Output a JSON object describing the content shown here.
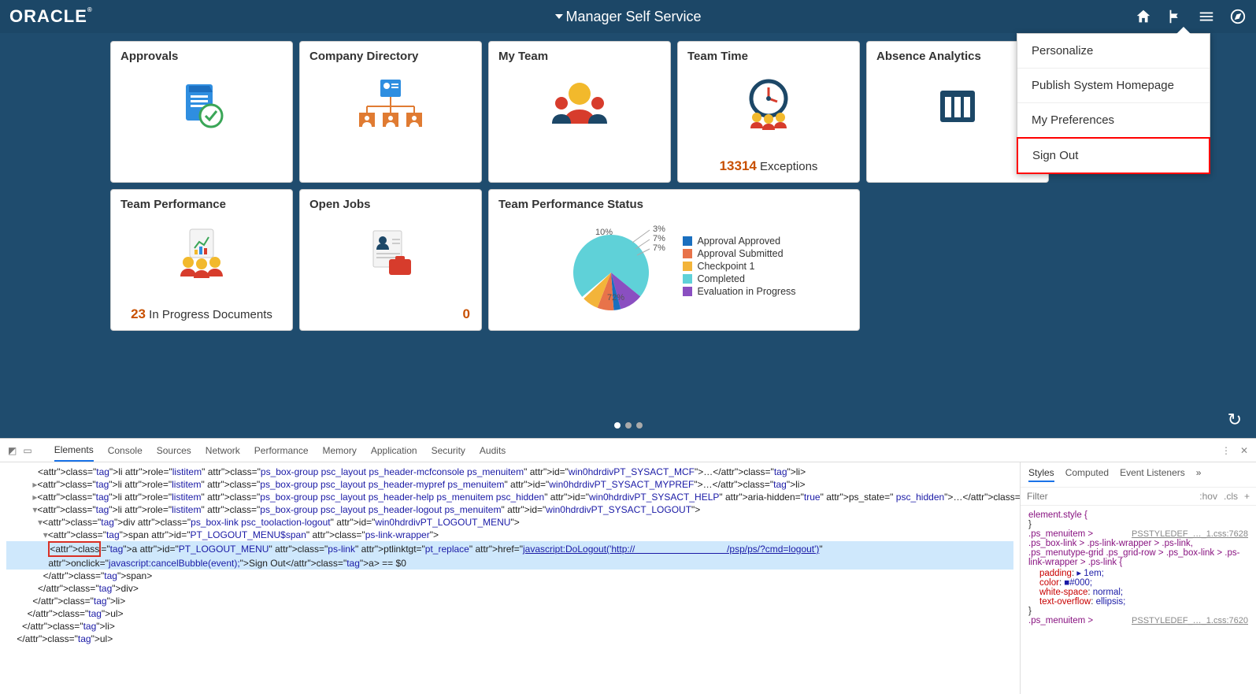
{
  "header": {
    "logo": "ORACLE",
    "title": "Manager Self Service"
  },
  "menu": {
    "items": [
      "Personalize",
      "Publish System Homepage",
      "My Preferences",
      "Sign Out"
    ],
    "highlight_index": 3
  },
  "tiles": {
    "approvals": {
      "title": "Approvals"
    },
    "directory": {
      "title": "Company Directory"
    },
    "myteam": {
      "title": "My Team"
    },
    "teamtime": {
      "title": "Team Time",
      "count": "13314",
      "label": "Exceptions"
    },
    "absence": {
      "title": "Absence Analytics"
    },
    "perf": {
      "title": "Team Performance",
      "count": "23",
      "label": "In Progress Documents"
    },
    "openjobs": {
      "title": "Open Jobs",
      "count": "0"
    },
    "status": {
      "title": "Team Performance Status"
    }
  },
  "chart_data": {
    "type": "pie",
    "slices": [
      {
        "label": "Approval Approved",
        "value": 3,
        "color": "#1a6fbf",
        "pct": "3%"
      },
      {
        "label": "Approval Submitted",
        "value": 7,
        "color": "#e8734a",
        "pct": "7%"
      },
      {
        "label": "Checkpoint 1",
        "value": 7,
        "color": "#f3b43a",
        "pct": "7%"
      },
      {
        "label": "Completed",
        "value": 72,
        "color": "#5fd1d8",
        "pct": "72%"
      },
      {
        "label": "Evaluation in Progress",
        "value": 10,
        "color": "#8a4fc1",
        "pct": "10%"
      }
    ],
    "label72": "72%",
    "label10": "10%",
    "label3": "3%",
    "label7a": "7%",
    "label7b": "7%"
  },
  "devtools": {
    "tabs": [
      "Elements",
      "Console",
      "Sources",
      "Network",
      "Performance",
      "Memory",
      "Application",
      "Security",
      "Audits"
    ],
    "side_tabs": [
      "Styles",
      "Computed",
      "Event Listeners"
    ],
    "filter_placeholder": "Filter",
    "hov": ":hov",
    "cls": ".cls",
    "rule1_sel": "element.style {",
    "rule2_sel": ".ps_menuitem >",
    "rule2_src": "PSSTYLEDEF_…_1.css:7628",
    "rule3_sel": ".ps_box-link > .ps-link-wrapper > .ps-link, .ps_menutype-grid .ps_grid-row > .ps_box-link > .ps-link-wrapper > .ps-link {",
    "p1": "padding",
    "v1": "▸ 1em;",
    "p2": "color",
    "v2": "■#000;",
    "p3": "white-space",
    "v3": "normal;",
    "p4": "text-overflow",
    "v4": "ellipsis;",
    "rule4_sel": ".ps_menuitem >",
    "rule4_src": "PSSTYLEDEF_…_1.css:7620",
    "dom": {
      "l1_pre": "<li role=\"listitem\" class=\"ps_box-group psc_layout ps_header-mcfconsole ps_menuitem\" id=\"win0hdrdivPT_SYSACT_MCF\">…</li>",
      "l2": "▸<li role=\"listitem\" class=\"ps_box-group psc_layout ps_header-mypref ps_menuitem\" id=\"win0hdrdivPT_SYSACT_MYPREF\">…</li>",
      "l3": "▸<li role=\"listitem\" class=\"ps_box-group psc_layout ps_header-help ps_menuitem psc_hidden\" id=\"win0hdrdivPT_SYSACT_HELP\" aria-hidden=\"true\" ps_state=\" psc_hidden\">…</li>",
      "l4": "▾<li role=\"listitem\" class=\"ps_box-group psc_layout ps_header-logout ps_menuitem\" id=\"win0hdrdivPT_SYSACT_LOGOUT\">",
      "l5": "▾<div class=\"ps_box-link psc_toolaction-logout\" id=\"win0hdrdivPT_LOGOUT_MENU\">",
      "l6": "▾<span id=\"PT_LOGOUT_MENU$span\" class=\"ps-link-wrapper\">",
      "l7a": "<a id=\"PT_LOGOUT_MENU\" class=\"ps-link\" ptlinktgt=\"pt_replace\" href=\"",
      "l7href": "javascript:DoLogout('http://                                   /psp/ps/?cmd=logout')",
      "l7b": "\" onclick=\"javascript:cancelBubble(event);\">Sign Out</a> == $0",
      "l8": "</span>",
      "l9": "</div>",
      "l10": "</li>",
      "l11": "</ul>",
      "l12": "</li>",
      "l13": "</ul>"
    }
  }
}
